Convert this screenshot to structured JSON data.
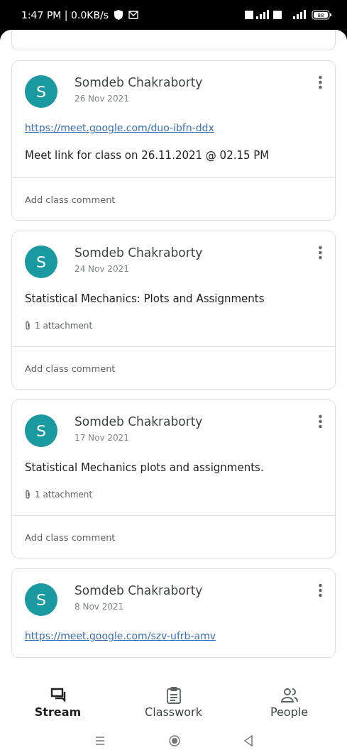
{
  "status_bar": {
    "time": "1:47 PM | 0.0KB/s",
    "battery": "88"
  },
  "posts": [
    {
      "author": "Somdeb Chakraborty",
      "avatar": "S",
      "date": "26 Nov 2021",
      "link": "https://meet.google.com/duo-ibfn-ddx",
      "text": "Meet link for class on 26.11.2021 @ 02.15 PM",
      "comment_placeholder": "Add class comment"
    },
    {
      "author": "Somdeb Chakraborty",
      "avatar": "S",
      "date": "24 Nov 2021",
      "text": "Statistical Mechanics: Plots and Assignments",
      "attachment": "1 attachment",
      "comment_placeholder": "Add class comment"
    },
    {
      "author": "Somdeb Chakraborty",
      "avatar": "S",
      "date": "17 Nov 2021",
      "text": "Statistical Mechanics plots and assignments.",
      "attachment": "1 attachment",
      "comment_placeholder": "Add class comment"
    },
    {
      "author": "Somdeb Chakraborty",
      "avatar": "S",
      "date": "8 Nov 2021",
      "link": "https://meet.google.com/szv-ufrb-amv"
    }
  ],
  "tabs": [
    {
      "kind": "stream",
      "label": "Stream",
      "selected": true
    },
    {
      "kind": "classwork",
      "label": "Classwork",
      "selected": false
    },
    {
      "kind": "people",
      "label": "People",
      "selected": false
    }
  ]
}
